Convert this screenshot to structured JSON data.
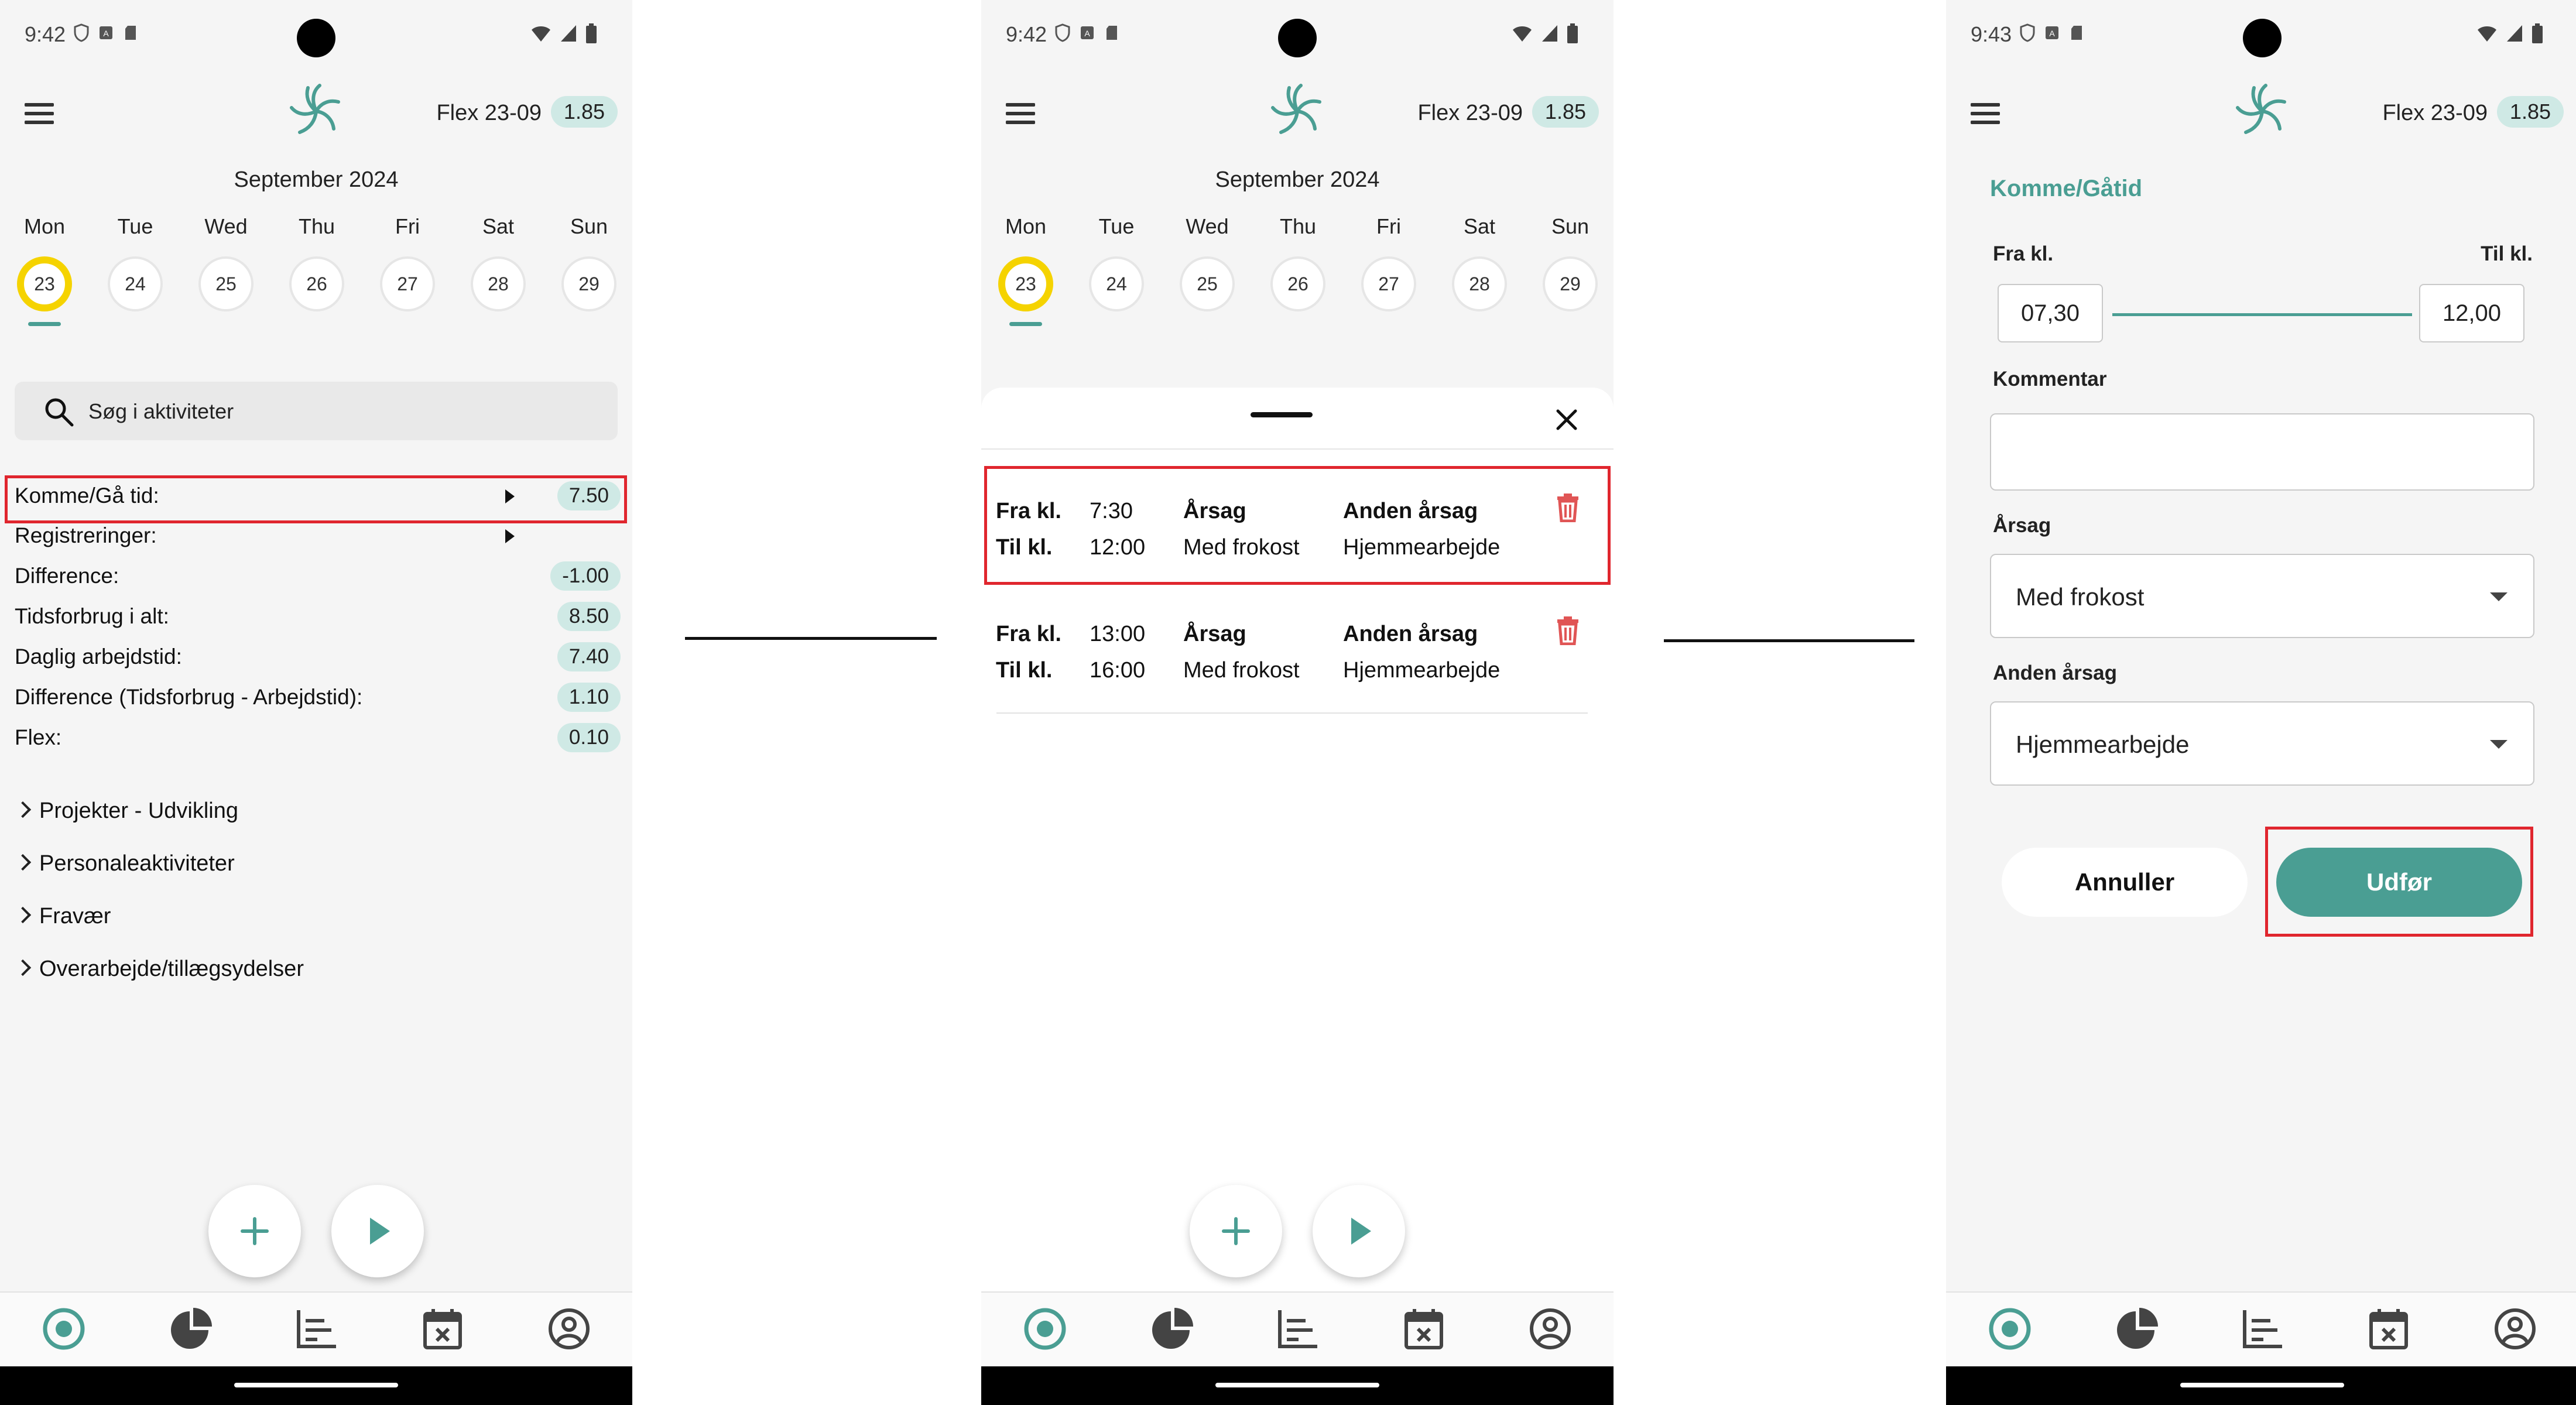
{
  "status": {
    "time_1": "9:42",
    "time_2": "9:42",
    "time_3": "9:43"
  },
  "header": {
    "title": "Flex 23-09",
    "flex_value": "1.85"
  },
  "calendar": {
    "month": "September 2024",
    "days": [
      {
        "name": "Mon",
        "num": "23"
      },
      {
        "name": "Tue",
        "num": "24"
      },
      {
        "name": "Wed",
        "num": "25"
      },
      {
        "name": "Thu",
        "num": "26"
      },
      {
        "name": "Fri",
        "num": "27"
      },
      {
        "name": "Sat",
        "num": "28"
      },
      {
        "name": "Sun",
        "num": "29"
      }
    ],
    "selected_index": 0
  },
  "search": {
    "placeholder": "Søg i aktiviteter"
  },
  "summary": {
    "komme": {
      "label": "Komme/Gå tid:",
      "value": "7.50"
    },
    "registreringer": {
      "label": "Registreringer:"
    },
    "difference": {
      "label": "Difference:",
      "value": "-1.00"
    },
    "tidsforbrug": {
      "label": "Tidsforbrug i alt:",
      "value": "8.50"
    },
    "daglig": {
      "label": "Daglig arbejdstid:",
      "value": "7.40"
    },
    "diff_tid": {
      "label": "Difference (Tidsforbrug - Arbejdstid):",
      "value": "1.10"
    },
    "flex": {
      "label": "Flex:",
      "value": "0.10"
    }
  },
  "sections": [
    "Projekter - Udvikling",
    "Personaleaktiviteter",
    "Fravær",
    "Overarbejde/tillægsydelser"
  ],
  "entries": [
    {
      "fra_label": "Fra kl.",
      "til_label": "Til kl.",
      "fra": "7:30",
      "til": "12:00",
      "aarsag_label": "Årsag",
      "aarsag": "Med frokost",
      "anden_label": "Anden årsag",
      "anden": "Hjemmearbejde"
    },
    {
      "fra_label": "Fra kl.",
      "til_label": "Til kl.",
      "fra": "13:00",
      "til": "16:00",
      "aarsag_label": "Årsag",
      "aarsag": "Med frokost",
      "anden_label": "Anden årsag",
      "anden": "Hjemmearbejde"
    }
  ],
  "form": {
    "title": "Komme/Gåtid",
    "fra_label": "Fra kl.",
    "til_label": "Til kl.",
    "fra_value": "07,30",
    "til_value": "12,00",
    "kommentar_label": "Kommentar",
    "aarsag_label": "Årsag",
    "aarsag_value": "Med frokost",
    "anden_label": "Anden årsag",
    "anden_value": "Hjemmearbejde",
    "cancel": "Annuller",
    "submit": "Udfør"
  },
  "nav": [
    "record-icon",
    "pie-chart-icon",
    "bar-chart-icon",
    "calendar-x-icon",
    "profile-icon"
  ],
  "colors": {
    "accent": "#4a9e93",
    "highlight": "#e0262e",
    "selected_day": "#f5d300",
    "badge": "#cfe9e5"
  }
}
